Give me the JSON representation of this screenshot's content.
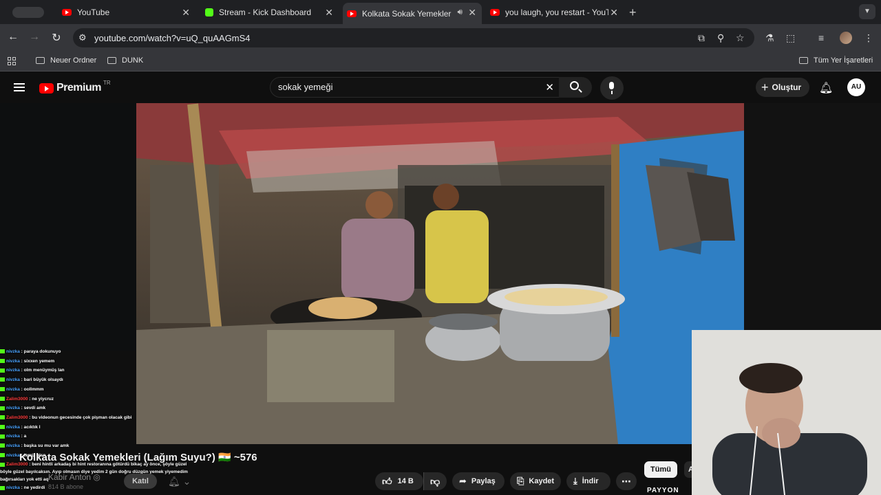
{
  "browser": {
    "tabs": [
      {
        "label": "YouTube",
        "icon": "youtube-icon"
      },
      {
        "label": "Stream - Kick Dashboard",
        "icon": "kick-icon"
      },
      {
        "label": "Kolkata Sokak Yemekleri (",
        "icon": "youtube-icon",
        "active": true
      },
      {
        "label": "you laugh, you restart - YouTu",
        "icon": "youtube-icon"
      }
    ],
    "url": "youtube.com/watch?v=uQ_quAAGmS4",
    "bookmarks": [
      "Neuer Ordner",
      "DUNK"
    ],
    "all_bookmarks_label": "Tüm Yer İşaretleri"
  },
  "youtube": {
    "logo_text": "Premium",
    "region": "TR",
    "search_value": "sokak yemeği",
    "create_label": "Oluştur",
    "account_initials": "AU"
  },
  "video": {
    "title": "Kolkata Sokak Yemekleri (Lağım Suyu?) 🇮🇳 ~576",
    "channel_name": "Kabir Anton ◎",
    "subscribers": "814 B abone",
    "join_label": "Katıl",
    "like_count": "14 B",
    "share_label": "Paylaş",
    "save_label": "Kaydet",
    "download_label": "İndir",
    "chip_all": "Tümü",
    "chip_next": "A"
  },
  "overlay": {
    "watermark": "PAYYON",
    "chat": [
      {
        "user": "nivzka",
        "msg": "paraya dokunuyo"
      },
      {
        "user": "nivzka",
        "msg": "sixxen yemem"
      },
      {
        "user": "nivzka",
        "msg": "olm menüymüş lan"
      },
      {
        "user": "nivzka",
        "msg": "bari büyük olsaydı"
      },
      {
        "user": "nivzka",
        "msg": "oollmmm"
      },
      {
        "user": "Zalim3000",
        "msg": "ne yiycruz"
      },
      {
        "user": "nivzka",
        "msg": "sevdi amk"
      },
      {
        "user": "Zalim3000",
        "msg": "bu videonun gecesinde çok pişman olacak gibi"
      },
      {
        "user": "nivzka",
        "msg": "acıktık l"
      },
      {
        "user": "nivzka",
        "msg": "a"
      },
      {
        "user": "nivzka",
        "msg": "başka su mu var amk"
      },
      {
        "user": "nivzka",
        "msg": "temiz olsn"
      },
      {
        "user": "Zalim3000",
        "msg": "beni hintli arkadaş bi hint restoranına götürdü bikaç ay önce, şöyle güzel böyle güzel bayılcaksın. Ayıp olmasın diye yedim 2 gün doğru düzgün yemek yiyemedim bağırsakları yok etti aq"
      },
      {
        "user": "nivzka",
        "msg": "ne yedirdi"
      }
    ]
  },
  "colors": {
    "youtube_red": "#ff0000",
    "kick_green": "#53fc18",
    "chat_user": "#4aa3ff"
  }
}
